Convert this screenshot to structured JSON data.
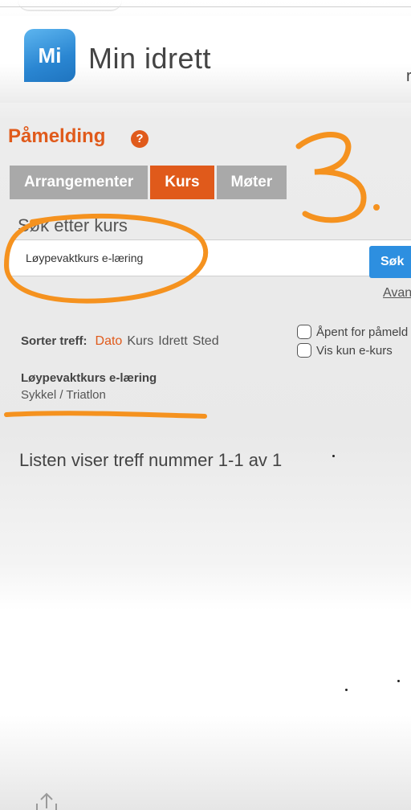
{
  "header": {
    "logo_badge": "Mi",
    "logo_text": "Min idrett",
    "edge_char": "r"
  },
  "page": {
    "title": "Påmelding",
    "help_icon": "?"
  },
  "tabs": [
    {
      "label": "Arrangementer",
      "active": false
    },
    {
      "label": "Kurs",
      "active": true
    },
    {
      "label": "Møter",
      "active": false
    }
  ],
  "search": {
    "label": "Søk etter kurs",
    "value": "Løypevaktkurs e-læring",
    "button": "Søk",
    "advanced_link": "Avan"
  },
  "sort": {
    "label": "Sorter treff:",
    "options": [
      {
        "label": "Dato",
        "active": true
      },
      {
        "label": "Kurs",
        "active": false
      },
      {
        "label": "Idrett",
        "active": false
      },
      {
        "label": "Sted",
        "active": false
      }
    ]
  },
  "filters": [
    {
      "label": "Åpent for påmeld",
      "checked": false
    },
    {
      "label": "Vis kun e-kurs",
      "checked": false
    }
  ],
  "result": {
    "title": "Løypevaktkurs e-læring",
    "subtitle": "Sykkel / Triatlon"
  },
  "list_summary": "Listen viser treff nummer 1-1 av 1",
  "annotation": {
    "number": "3.",
    "color": "#f5921f"
  },
  "colors": {
    "accent": "#e05a1b",
    "button": "#2d8fe0",
    "tab_inactive": "#a9a9a9"
  },
  "icons": {
    "help": "help-icon",
    "share": "share-icon"
  }
}
